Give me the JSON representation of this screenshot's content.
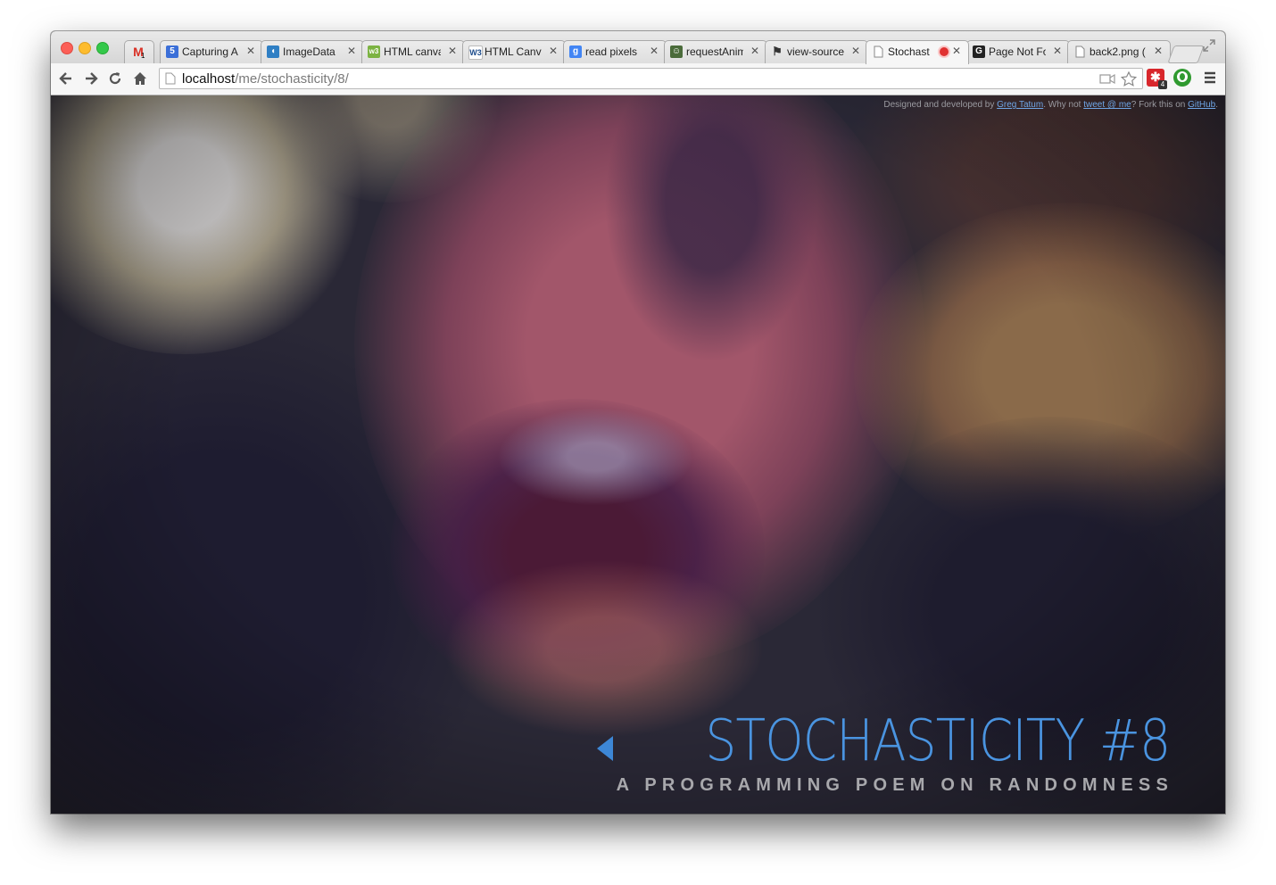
{
  "browser": {
    "tabs": [
      {
        "title": "",
        "icon": "gmail-icon",
        "badge": "1"
      },
      {
        "title": "Capturing A",
        "icon": "html5-icon"
      },
      {
        "title": "ImageData",
        "icon": "mdn-icon"
      },
      {
        "title": "HTML canva",
        "icon": "w3schools-icon"
      },
      {
        "title": "HTML Canv",
        "icon": "w3c-icon"
      },
      {
        "title": "read pixels",
        "icon": "google-icon"
      },
      {
        "title": "requestAnim",
        "icon": "avatar-icon"
      },
      {
        "title": "view-source",
        "icon": "github-octocat-icon"
      },
      {
        "title": "Stochast",
        "icon": "page-icon",
        "active": true,
        "recording": true
      },
      {
        "title": "Page Not Fo",
        "icon": "github-icon"
      },
      {
        "title": "back2.png (",
        "icon": "page-icon"
      }
    ],
    "address": {
      "host": "localhost",
      "path": "/me/stochasticity/8/"
    }
  },
  "page": {
    "credit": {
      "prefix": "Designed and developed by ",
      "author": "Greg Tatum",
      "middle": ". Why not ",
      "tweet": "tweet @ me",
      "fork_text": "? Fork this on ",
      "github": "GitHub",
      "end": "."
    },
    "title": "STOCHASTICITY #8",
    "subtitle": "A PROGRAMMING POEM ON RANDOMNESS"
  }
}
